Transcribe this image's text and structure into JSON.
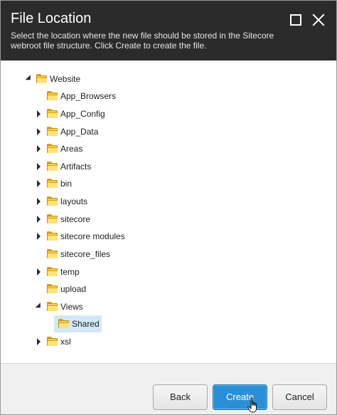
{
  "dialog": {
    "title": "File Location",
    "description": "Select the location where the new file should be stored in the Sitecore webroot file structure. Click Create to create the file."
  },
  "tree": {
    "items": [
      {
        "label": "Website",
        "expander": "expanded"
      },
      {
        "label": "App_Browsers",
        "expander": "none"
      },
      {
        "label": "App_Config",
        "expander": "collapsed"
      },
      {
        "label": "App_Data",
        "expander": "collapsed"
      },
      {
        "label": "Areas",
        "expander": "collapsed"
      },
      {
        "label": "Artifacts",
        "expander": "collapsed"
      },
      {
        "label": "bin",
        "expander": "collapsed"
      },
      {
        "label": "layouts",
        "expander": "collapsed"
      },
      {
        "label": "sitecore",
        "expander": "collapsed"
      },
      {
        "label": "sitecore modules",
        "expander": "collapsed"
      },
      {
        "label": "sitecore_files",
        "expander": "none"
      },
      {
        "label": "temp",
        "expander": "collapsed"
      },
      {
        "label": "upload",
        "expander": "none"
      },
      {
        "label": "Views",
        "expander": "expanded"
      },
      {
        "label": "Shared",
        "expander": "none",
        "selected": true
      },
      {
        "label": "xsl",
        "expander": "collapsed"
      }
    ]
  },
  "buttons": {
    "back": "Back",
    "create": "Create",
    "cancel": "Cancel"
  },
  "colors": {
    "header_bg": "#2b2b2b",
    "primary": "#2a8fd6",
    "selection": "#d3e8f7",
    "folder": "#f6cf49"
  }
}
